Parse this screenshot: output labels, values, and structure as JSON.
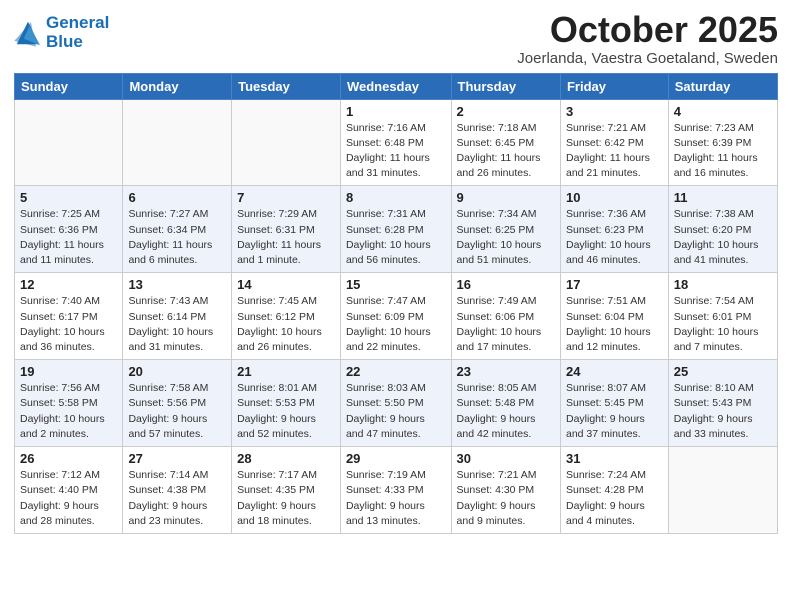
{
  "header": {
    "logo_line1": "General",
    "logo_line2": "Blue",
    "month": "October 2025",
    "location": "Joerlanda, Vaestra Goetaland, Sweden"
  },
  "weekdays": [
    "Sunday",
    "Monday",
    "Tuesday",
    "Wednesday",
    "Thursday",
    "Friday",
    "Saturday"
  ],
  "weeks": [
    [
      {
        "day": "",
        "info": ""
      },
      {
        "day": "",
        "info": ""
      },
      {
        "day": "",
        "info": ""
      },
      {
        "day": "1",
        "info": "Sunrise: 7:16 AM\nSunset: 6:48 PM\nDaylight: 11 hours\nand 31 minutes."
      },
      {
        "day": "2",
        "info": "Sunrise: 7:18 AM\nSunset: 6:45 PM\nDaylight: 11 hours\nand 26 minutes."
      },
      {
        "day": "3",
        "info": "Sunrise: 7:21 AM\nSunset: 6:42 PM\nDaylight: 11 hours\nand 21 minutes."
      },
      {
        "day": "4",
        "info": "Sunrise: 7:23 AM\nSunset: 6:39 PM\nDaylight: 11 hours\nand 16 minutes."
      }
    ],
    [
      {
        "day": "5",
        "info": "Sunrise: 7:25 AM\nSunset: 6:36 PM\nDaylight: 11 hours\nand 11 minutes."
      },
      {
        "day": "6",
        "info": "Sunrise: 7:27 AM\nSunset: 6:34 PM\nDaylight: 11 hours\nand 6 minutes."
      },
      {
        "day": "7",
        "info": "Sunrise: 7:29 AM\nSunset: 6:31 PM\nDaylight: 11 hours\nand 1 minute."
      },
      {
        "day": "8",
        "info": "Sunrise: 7:31 AM\nSunset: 6:28 PM\nDaylight: 10 hours\nand 56 minutes."
      },
      {
        "day": "9",
        "info": "Sunrise: 7:34 AM\nSunset: 6:25 PM\nDaylight: 10 hours\nand 51 minutes."
      },
      {
        "day": "10",
        "info": "Sunrise: 7:36 AM\nSunset: 6:23 PM\nDaylight: 10 hours\nand 46 minutes."
      },
      {
        "day": "11",
        "info": "Sunrise: 7:38 AM\nSunset: 6:20 PM\nDaylight: 10 hours\nand 41 minutes."
      }
    ],
    [
      {
        "day": "12",
        "info": "Sunrise: 7:40 AM\nSunset: 6:17 PM\nDaylight: 10 hours\nand 36 minutes."
      },
      {
        "day": "13",
        "info": "Sunrise: 7:43 AM\nSunset: 6:14 PM\nDaylight: 10 hours\nand 31 minutes."
      },
      {
        "day": "14",
        "info": "Sunrise: 7:45 AM\nSunset: 6:12 PM\nDaylight: 10 hours\nand 26 minutes."
      },
      {
        "day": "15",
        "info": "Sunrise: 7:47 AM\nSunset: 6:09 PM\nDaylight: 10 hours\nand 22 minutes."
      },
      {
        "day": "16",
        "info": "Sunrise: 7:49 AM\nSunset: 6:06 PM\nDaylight: 10 hours\nand 17 minutes."
      },
      {
        "day": "17",
        "info": "Sunrise: 7:51 AM\nSunset: 6:04 PM\nDaylight: 10 hours\nand 12 minutes."
      },
      {
        "day": "18",
        "info": "Sunrise: 7:54 AM\nSunset: 6:01 PM\nDaylight: 10 hours\nand 7 minutes."
      }
    ],
    [
      {
        "day": "19",
        "info": "Sunrise: 7:56 AM\nSunset: 5:58 PM\nDaylight: 10 hours\nand 2 minutes."
      },
      {
        "day": "20",
        "info": "Sunrise: 7:58 AM\nSunset: 5:56 PM\nDaylight: 9 hours\nand 57 minutes."
      },
      {
        "day": "21",
        "info": "Sunrise: 8:01 AM\nSunset: 5:53 PM\nDaylight: 9 hours\nand 52 minutes."
      },
      {
        "day": "22",
        "info": "Sunrise: 8:03 AM\nSunset: 5:50 PM\nDaylight: 9 hours\nand 47 minutes."
      },
      {
        "day": "23",
        "info": "Sunrise: 8:05 AM\nSunset: 5:48 PM\nDaylight: 9 hours\nand 42 minutes."
      },
      {
        "day": "24",
        "info": "Sunrise: 8:07 AM\nSunset: 5:45 PM\nDaylight: 9 hours\nand 37 minutes."
      },
      {
        "day": "25",
        "info": "Sunrise: 8:10 AM\nSunset: 5:43 PM\nDaylight: 9 hours\nand 33 minutes."
      }
    ],
    [
      {
        "day": "26",
        "info": "Sunrise: 7:12 AM\nSunset: 4:40 PM\nDaylight: 9 hours\nand 28 minutes."
      },
      {
        "day": "27",
        "info": "Sunrise: 7:14 AM\nSunset: 4:38 PM\nDaylight: 9 hours\nand 23 minutes."
      },
      {
        "day": "28",
        "info": "Sunrise: 7:17 AM\nSunset: 4:35 PM\nDaylight: 9 hours\nand 18 minutes."
      },
      {
        "day": "29",
        "info": "Sunrise: 7:19 AM\nSunset: 4:33 PM\nDaylight: 9 hours\nand 13 minutes."
      },
      {
        "day": "30",
        "info": "Sunrise: 7:21 AM\nSunset: 4:30 PM\nDaylight: 9 hours\nand 9 minutes."
      },
      {
        "day": "31",
        "info": "Sunrise: 7:24 AM\nSunset: 4:28 PM\nDaylight: 9 hours\nand 4 minutes."
      },
      {
        "day": "",
        "info": ""
      }
    ]
  ]
}
